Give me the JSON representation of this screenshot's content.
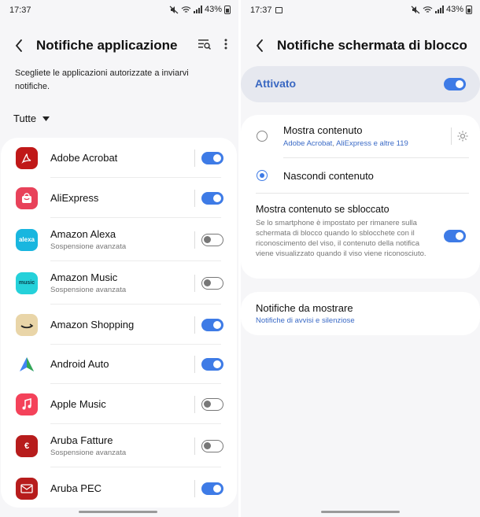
{
  "status": {
    "left_time": "17:37",
    "right_time": "17:37",
    "battery": "43%"
  },
  "left": {
    "title": "Notifiche applicazione",
    "description": "Scegliete le applicazioni autorizzate a inviarvi notifiche.",
    "filter_label": "Tutte",
    "apps": [
      {
        "name": "Adobe Acrobat",
        "sub": "",
        "enabled": true,
        "icon": "acrobat-icon",
        "color": "#c01818"
      },
      {
        "name": "AliExpress",
        "sub": "",
        "enabled": true,
        "icon": "aliexpress-icon",
        "color": "#e8425a"
      },
      {
        "name": "Amazon Alexa",
        "sub": "Sospensione avanzata",
        "enabled": false,
        "icon": "alexa-icon",
        "color": "#19b6df"
      },
      {
        "name": "Amazon Music",
        "sub": "Sospensione avanzata",
        "enabled": false,
        "icon": "amazon-music-icon",
        "color": "#25d1da"
      },
      {
        "name": "Amazon Shopping",
        "sub": "",
        "enabled": true,
        "icon": "amazon-shopping-icon",
        "color": "#e9d5a8"
      },
      {
        "name": "Android Auto",
        "sub": "",
        "enabled": true,
        "icon": "android-auto-icon",
        "color": "#ffffff"
      },
      {
        "name": "Apple Music",
        "sub": "",
        "enabled": false,
        "icon": "apple-music-icon",
        "color": "#f4425a"
      },
      {
        "name": "Aruba Fatture",
        "sub": "Sospensione avanzata",
        "enabled": false,
        "icon": "aruba-fatture-icon",
        "color": "#b71c1c"
      },
      {
        "name": "Aruba PEC",
        "sub": "",
        "enabled": true,
        "icon": "aruba-pec-icon",
        "color": "#b71c1c"
      }
    ]
  },
  "right": {
    "title": "Notifiche schermata di blocco",
    "activated_label": "Attivato",
    "activated_on": true,
    "show_content": {
      "title": "Mostra contenuto",
      "sub_apps": "Adobe Acrobat",
      "sub_sep": ", ",
      "sub_apps2": "AliExpress",
      "sub_rest": " e altre 119"
    },
    "hide_content": {
      "title": "Nascondi contenuto"
    },
    "unlocked": {
      "title": "Mostra contenuto se sbloccato",
      "description": "Se lo smartphone è impostato per rimanere sulla schermata di blocco quando lo sblocchete con il riconoscimento del viso, il contenuto della notifica viene visualizzato quando il viso viene riconosciuto.",
      "enabled": true
    },
    "notifications_to_show": {
      "title": "Notifiche da mostrare",
      "sub": "Notifiche di avvisi e silenziose"
    }
  },
  "colors": {
    "accent": "#3e7be6",
    "link": "#3a6ac6"
  }
}
